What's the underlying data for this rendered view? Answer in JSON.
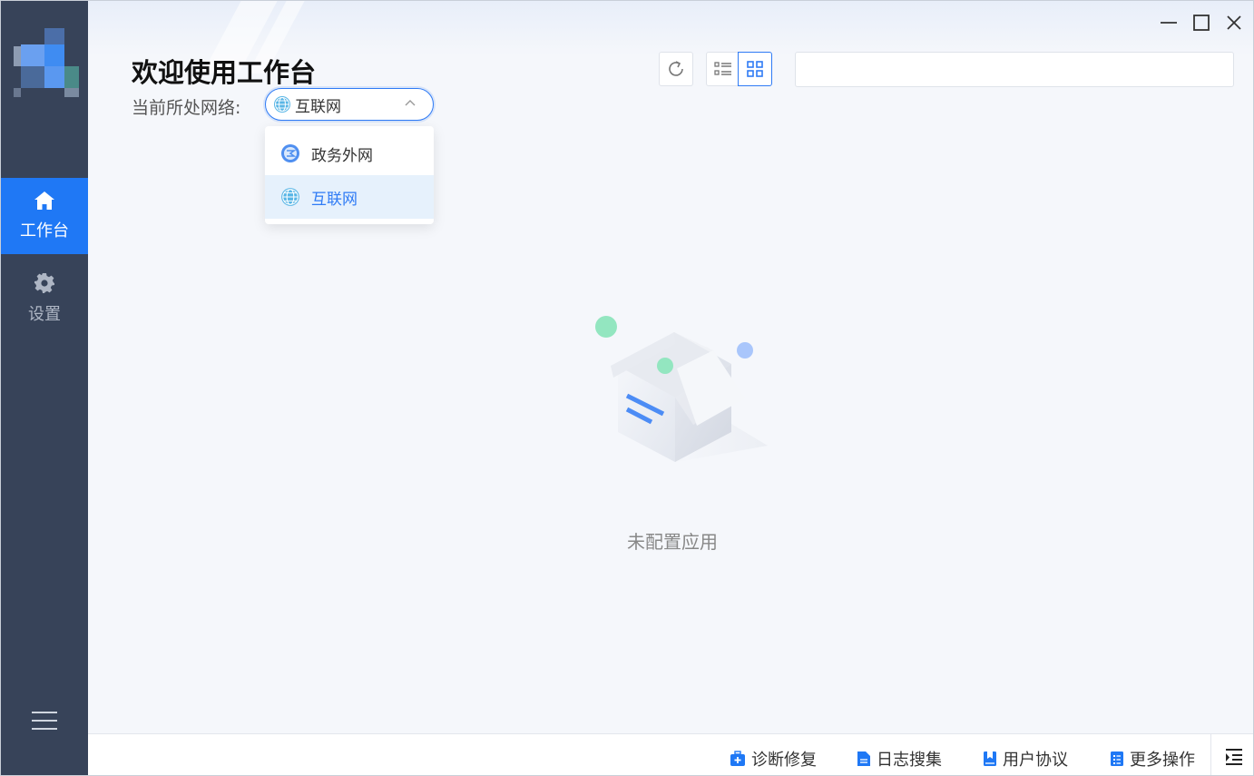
{
  "sidebar": {
    "items": [
      {
        "label": "工作台",
        "icon": "home-icon",
        "active": true
      },
      {
        "label": "设置",
        "icon": "gear-icon",
        "active": false
      }
    ],
    "menu_icon": "hamburger-menu-icon"
  },
  "header": {
    "title": "欢迎使用工作台",
    "network_label": "当前所处网络:",
    "network_selected": "互联网",
    "network_options": [
      {
        "label": "政务外网",
        "icon": "gov-network-icon",
        "selected": false
      },
      {
        "label": "互联网",
        "icon": "globe-icon",
        "selected": true
      }
    ]
  },
  "toolbar": {
    "refresh_icon": "refresh-icon",
    "list_view_icon": "list-view-icon",
    "grid_view_icon": "grid-view-icon",
    "view_mode": "grid",
    "search_value": "",
    "search_placeholder": ""
  },
  "empty_state": {
    "text": "未配置应用",
    "icon": "empty-box-illustration"
  },
  "footer": {
    "items": [
      {
        "label": "诊断修复",
        "icon": "medical-kit-icon"
      },
      {
        "label": "日志搜集",
        "icon": "document-icon"
      },
      {
        "label": "用户协议",
        "icon": "bookmark-book-icon"
      },
      {
        "label": "更多操作",
        "icon": "list-doc-icon"
      }
    ],
    "collapse_icon": "indent-collapse-icon"
  },
  "colors": {
    "sidebar_bg": "#374359",
    "accent": "#1f78f5",
    "selected_bg": "#e6f1fc"
  }
}
